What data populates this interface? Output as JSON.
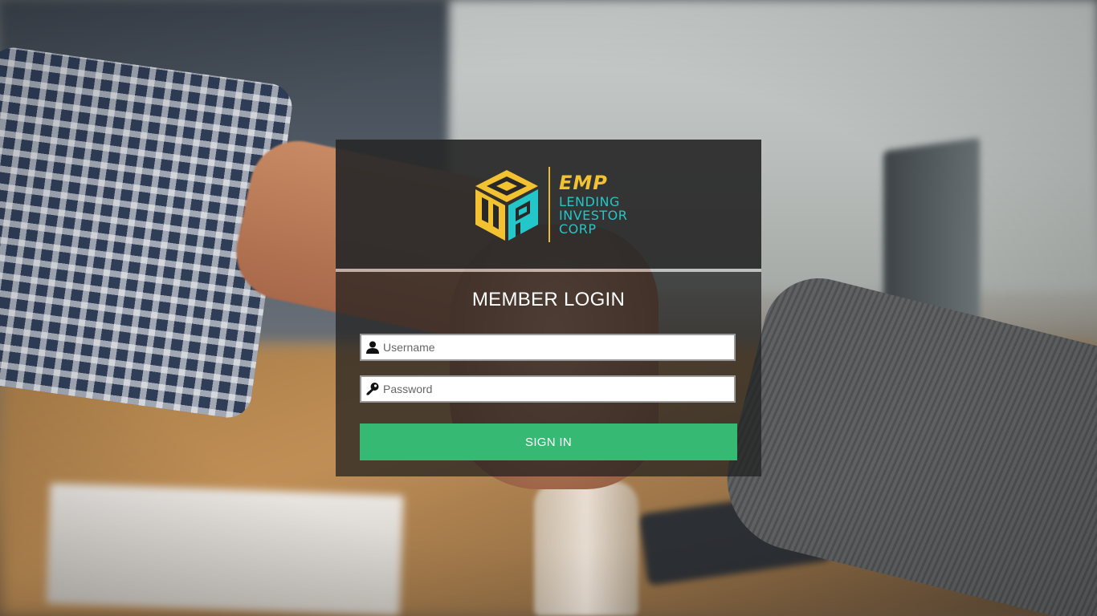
{
  "brand": {
    "short_name": "EMP",
    "line1": "LENDING",
    "line2": "INVESTOR",
    "line3": "CORP",
    "colors": {
      "gold": "#f2c230",
      "teal": "#23c6c9"
    }
  },
  "login": {
    "title": "MEMBER LOGIN",
    "username": {
      "placeholder": "Username",
      "value": "",
      "icon": "user-icon"
    },
    "password": {
      "placeholder": "Password",
      "value": "",
      "icon": "key-icon"
    },
    "submit_label": "SIGN IN",
    "accent": "#36b973"
  }
}
